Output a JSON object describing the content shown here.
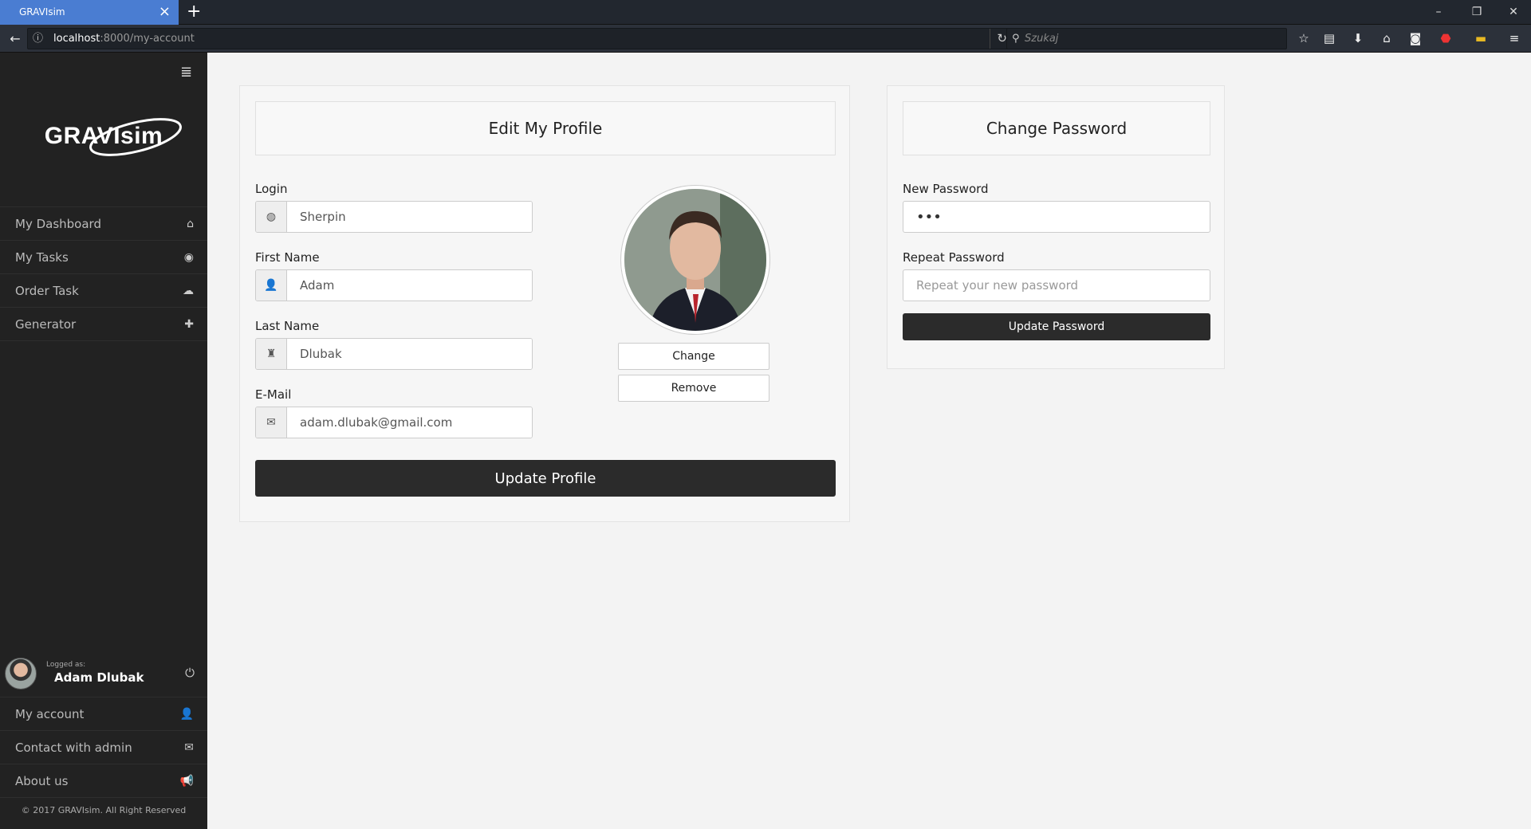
{
  "browser": {
    "tab_title": "GRAVIsim",
    "tab_close": "×",
    "new_tab": "+",
    "url_host": "localhost",
    "url_path": ":8000/my-account",
    "search_placeholder": "Szukaj"
  },
  "sidebar": {
    "logo": "GRAVIsim",
    "menu": [
      {
        "label": "My Dashboard",
        "icon": "home-icon"
      },
      {
        "label": "My Tasks",
        "icon": "eye-icon"
      },
      {
        "label": "Order Task",
        "icon": "cloud-upload-icon"
      },
      {
        "label": "Generator",
        "icon": "plus-icon"
      }
    ],
    "user": {
      "logged_as": "Logged as:",
      "name": "Adam Dlubak"
    },
    "bottom_menu": [
      {
        "label": "My account",
        "icon": "user-icon"
      },
      {
        "label": "Contact with admin",
        "icon": "envelope-icon"
      },
      {
        "label": "About us",
        "icon": "megaphone-icon"
      }
    ],
    "copyright": "© 2017 GRAVIsim. All Right Reserved"
  },
  "profile": {
    "title": "Edit My Profile",
    "fields": [
      {
        "label": "Login",
        "value": "Sherpin",
        "icon": "globe-icon"
      },
      {
        "label": "First Name",
        "value": "Adam",
        "icon": "user-icon"
      },
      {
        "label": "Last Name",
        "value": "Dlubak",
        "icon": "tower-icon"
      },
      {
        "label": "E-Mail",
        "value": "adam.dlubak@gmail.com",
        "icon": "envelope-icon"
      }
    ],
    "change_label": "Change",
    "remove_label": "Remove",
    "submit_label": "Update Profile"
  },
  "password": {
    "title": "Change Password",
    "new_label": "New Password",
    "new_value": "•••",
    "repeat_label": "Repeat Password",
    "repeat_placeholder": "Repeat your new password",
    "submit_label": "Update Password"
  },
  "colors": {
    "sidebar_bg": "#222222",
    "button_dark": "#2b2b2b",
    "tab_active": "#4a7dd2"
  }
}
